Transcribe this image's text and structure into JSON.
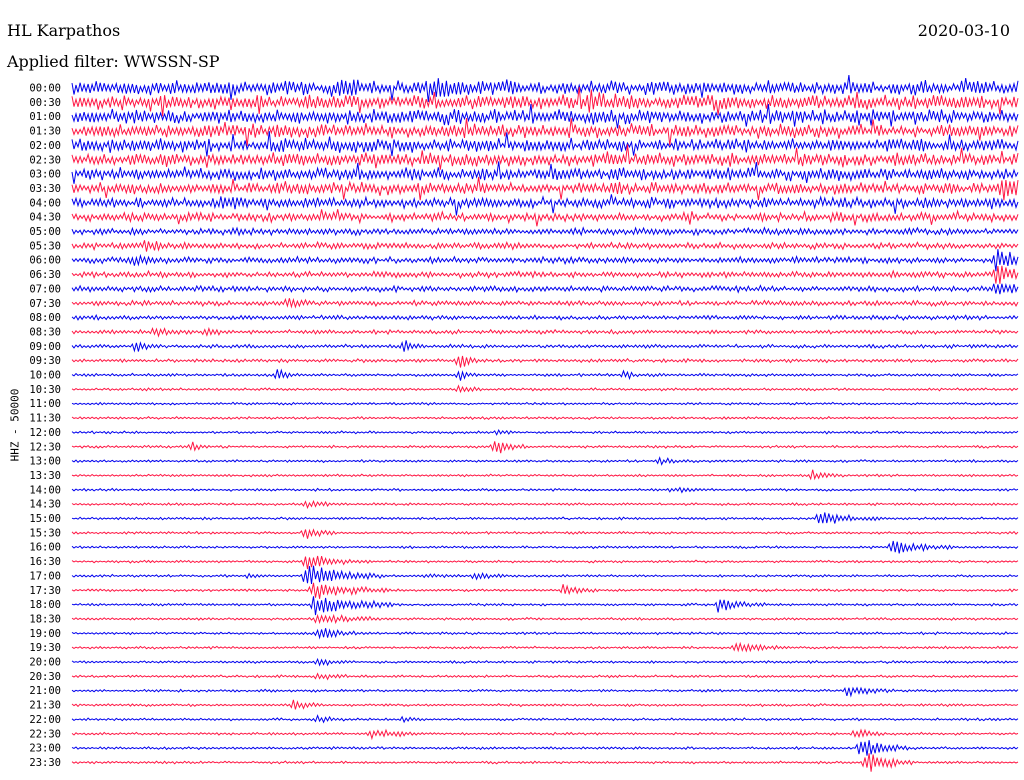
{
  "header": {
    "station": "HL Karpathos",
    "date": "2020-03-10",
    "filter": "Applied filter: WWSSN-SP"
  },
  "colors": {
    "trace_a": "#0000ee",
    "trace_b": "#ff1744"
  },
  "chart_data": {
    "type": "line",
    "title": "HL Karpathos",
    "ylabel": "HHZ - 50000",
    "x_range_minutes": [
      0,
      30
    ],
    "time_labels": [
      "00:00",
      "00:30",
      "01:00",
      "01:30",
      "02:00",
      "02:30",
      "03:00",
      "03:30",
      "04:00",
      "04:30",
      "05:00",
      "05:30",
      "06:00",
      "06:30",
      "07:00",
      "07:30",
      "08:00",
      "08:30",
      "09:00",
      "09:30",
      "10:00",
      "10:30",
      "11:00",
      "11:30",
      "12:00",
      "12:30",
      "13:00",
      "13:30",
      "14:00",
      "14:30",
      "15:00",
      "15:30",
      "16:00",
      "16:30",
      "17:00",
      "17:30",
      "18:00",
      "18:30",
      "19:00",
      "19:30",
      "20:00",
      "20:30",
      "21:00",
      "21:30",
      "22:00",
      "22:30",
      "23:00",
      "23:30"
    ],
    "noise_level": [
      1.7,
      1.75,
      1.7,
      1.65,
      1.6,
      1.55,
      1.5,
      1.4,
      1.25,
      1.05,
      0.85,
      0.8,
      0.8,
      0.75,
      0.7,
      0.62,
      0.55,
      0.5,
      0.45,
      0.42,
      0.35,
      0.32,
      0.3,
      0.3,
      0.3,
      0.3,
      0.3,
      0.3,
      0.3,
      0.3,
      0.3,
      0.3,
      0.3,
      0.3,
      0.3,
      0.3,
      0.3,
      0.3,
      0.3,
      0.3,
      0.3,
      0.3,
      0.3,
      0.3,
      0.3,
      0.3,
      0.3,
      0.3
    ],
    "events": [
      {
        "trace": 0,
        "minute": 8.5,
        "amp": 2.0,
        "dur": 1.2
      },
      {
        "trace": 0,
        "minute": 11.5,
        "amp": 3.0,
        "dur": 0.8
      },
      {
        "trace": 1,
        "minute": 16.4,
        "amp": 2.5,
        "dur": 1.0
      },
      {
        "trace": 7,
        "minute": 29.5,
        "amp": 5.0,
        "dur": 1.5
      },
      {
        "trace": 8,
        "minute": 4.8,
        "amp": 1.8,
        "dur": 1.0
      },
      {
        "trace": 11,
        "minute": 2.3,
        "amp": 1.6,
        "dur": 1.0
      },
      {
        "trace": 12,
        "minute": 2.0,
        "amp": 1.5,
        "dur": 0.8
      },
      {
        "trace": 12,
        "minute": 29.3,
        "amp": 4.5,
        "dur": 1.0
      },
      {
        "trace": 13,
        "minute": 29.3,
        "amp": 4.0,
        "dur": 1.0
      },
      {
        "trace": 14,
        "minute": 29.3,
        "amp": 3.0,
        "dur": 1.0
      },
      {
        "trace": 15,
        "minute": 6.8,
        "amp": 1.4,
        "dur": 0.8
      },
      {
        "trace": 17,
        "minute": 2.6,
        "amp": 1.2,
        "dur": 0.8
      },
      {
        "trace": 17,
        "minute": 4.2,
        "amp": 1.2,
        "dur": 0.8
      },
      {
        "trace": 18,
        "minute": 2.0,
        "amp": 1.5,
        "dur": 0.8
      },
      {
        "trace": 18,
        "minute": 10.5,
        "amp": 1.8,
        "dur": 0.6
      },
      {
        "trace": 19,
        "minute": 12.3,
        "amp": 2.5,
        "dur": 0.6
      },
      {
        "trace": 20,
        "minute": 12.3,
        "amp": 2.0,
        "dur": 0.6
      },
      {
        "trace": 20,
        "minute": 6.5,
        "amp": 2.0,
        "dur": 0.6
      },
      {
        "trace": 20,
        "minute": 17.5,
        "amp": 1.2,
        "dur": 0.6
      },
      {
        "trace": 21,
        "minute": 12.3,
        "amp": 1.5,
        "dur": 0.6
      },
      {
        "trace": 24,
        "minute": 13.5,
        "amp": 1.0,
        "dur": 0.6
      },
      {
        "trace": 25,
        "minute": 3.8,
        "amp": 1.5,
        "dur": 0.6
      },
      {
        "trace": 25,
        "minute": 13.4,
        "amp": 2.5,
        "dur": 1.0
      },
      {
        "trace": 26,
        "minute": 18.6,
        "amp": 1.2,
        "dur": 1.0
      },
      {
        "trace": 27,
        "minute": 23.5,
        "amp": 1.5,
        "dur": 1.0
      },
      {
        "trace": 28,
        "minute": 19.0,
        "amp": 0.8,
        "dur": 1.5
      },
      {
        "trace": 29,
        "minute": 7.4,
        "amp": 1.2,
        "dur": 1.0
      },
      {
        "trace": 30,
        "minute": 23.7,
        "amp": 2.2,
        "dur": 2.0
      },
      {
        "trace": 31,
        "minute": 7.4,
        "amp": 2.0,
        "dur": 1.0
      },
      {
        "trace": 32,
        "minute": 26.0,
        "amp": 2.2,
        "dur": 2.0
      },
      {
        "trace": 33,
        "minute": 7.4,
        "amp": 2.5,
        "dur": 2.0
      },
      {
        "trace": 34,
        "minute": 7.4,
        "amp": 3.5,
        "dur": 2.5
      },
      {
        "trace": 34,
        "minute": 5.6,
        "amp": 0.8,
        "dur": 0.8
      },
      {
        "trace": 34,
        "minute": 11.2,
        "amp": 0.8,
        "dur": 1.0
      },
      {
        "trace": 34,
        "minute": 12.8,
        "amp": 1.2,
        "dur": 1.0
      },
      {
        "trace": 35,
        "minute": 7.6,
        "amp": 3.0,
        "dur": 2.5
      },
      {
        "trace": 35,
        "minute": 15.6,
        "amp": 1.5,
        "dur": 1.0
      },
      {
        "trace": 36,
        "minute": 7.7,
        "amp": 3.5,
        "dur": 2.5
      },
      {
        "trace": 36,
        "minute": 20.5,
        "amp": 2.0,
        "dur": 1.5
      },
      {
        "trace": 37,
        "minute": 7.8,
        "amp": 2.0,
        "dur": 2.0
      },
      {
        "trace": 38,
        "minute": 7.8,
        "amp": 2.0,
        "dur": 1.5
      },
      {
        "trace": 39,
        "minute": 21.0,
        "amp": 2.0,
        "dur": 1.5
      },
      {
        "trace": 40,
        "minute": 7.8,
        "amp": 1.5,
        "dur": 1.0
      },
      {
        "trace": 41,
        "minute": 7.8,
        "amp": 1.2,
        "dur": 1.0
      },
      {
        "trace": 42,
        "minute": 24.6,
        "amp": 2.0,
        "dur": 1.5
      },
      {
        "trace": 43,
        "minute": 7.0,
        "amp": 1.5,
        "dur": 1.0
      },
      {
        "trace": 44,
        "minute": 7.8,
        "amp": 1.2,
        "dur": 1.0
      },
      {
        "trace": 44,
        "minute": 10.5,
        "amp": 0.8,
        "dur": 0.8
      },
      {
        "trace": 45,
        "minute": 9.5,
        "amp": 1.5,
        "dur": 2.0
      },
      {
        "trace": 45,
        "minute": 24.8,
        "amp": 2.0,
        "dur": 1.0
      },
      {
        "trace": 46,
        "minute": 25.0,
        "amp": 3.5,
        "dur": 1.5
      },
      {
        "trace": 47,
        "minute": 25.2,
        "amp": 3.5,
        "dur": 1.5
      }
    ]
  }
}
